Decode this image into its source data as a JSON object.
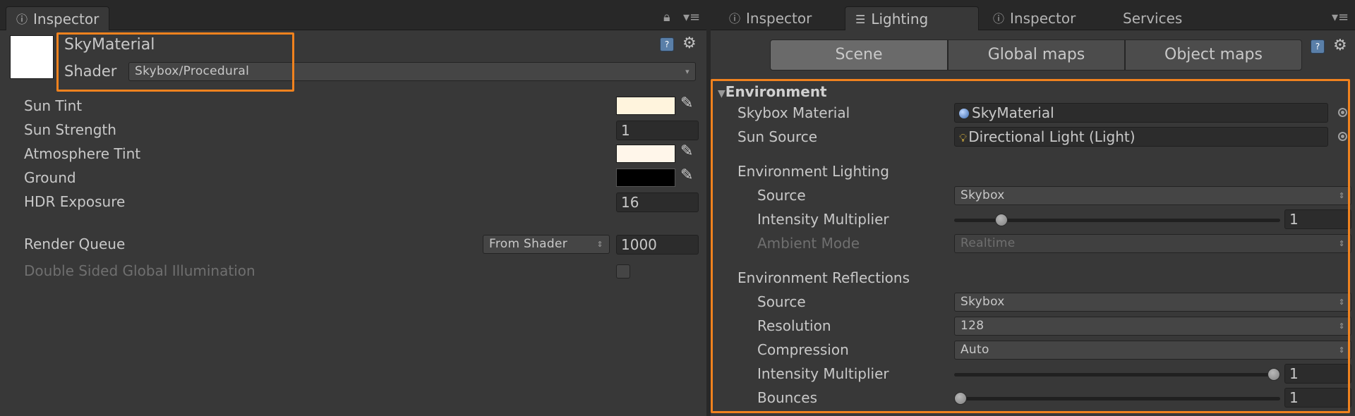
{
  "left": {
    "tab_label": "Inspector",
    "material_name": "SkyMaterial",
    "shader_label": "Shader",
    "shader_value": "Skybox/Procedural",
    "properties": [
      {
        "label": "Sun Tint",
        "color": "#fff4dd"
      },
      {
        "label": "Sun Strength",
        "value": "1"
      },
      {
        "label": "Atmosphere Tint",
        "color": "#fff6ea"
      },
      {
        "label": "Ground",
        "color": "#000000"
      },
      {
        "label": "HDR Exposure",
        "value": "16"
      }
    ],
    "render_queue": {
      "label": "Render Queue",
      "mode": "From Shader",
      "value": "1000"
    },
    "double_sided_gi": {
      "label": "Double Sided Global Illumination",
      "checked": false
    }
  },
  "right": {
    "tabs": [
      "Inspector",
      "Lighting",
      "Inspector",
      "Services"
    ],
    "active_tab": "Lighting",
    "segments": [
      "Scene",
      "Global maps",
      "Object maps"
    ],
    "active_segment": "Scene",
    "section_title": "Environment",
    "skybox_material": {
      "label": "Skybox Material",
      "value": "SkyMaterial"
    },
    "sun_source": {
      "label": "Sun Source",
      "value": "Directional Light (Light)"
    },
    "env_lighting": {
      "title": "Environment Lighting",
      "source": {
        "label": "Source",
        "value": "Skybox"
      },
      "intensity": {
        "label": "Intensity Multiplier",
        "value": "1",
        "fraction": 0.13
      },
      "ambient_mode": {
        "label": "Ambient Mode",
        "value": "Realtime"
      }
    },
    "env_reflections": {
      "title": "Environment Reflections",
      "source": {
        "label": "Source",
        "value": "Skybox"
      },
      "resolution": {
        "label": "Resolution",
        "value": "128"
      },
      "compression": {
        "label": "Compression",
        "value": "Auto"
      },
      "intensity": {
        "label": "Intensity Multiplier",
        "value": "1",
        "fraction": 1.0
      },
      "bounces": {
        "label": "Bounces",
        "value": "1",
        "fraction": 0.0
      }
    }
  },
  "colors": {
    "highlight": "#f0821e",
    "panel": "#383838",
    "tabbar": "#282828"
  },
  "icons": [
    "info-icon",
    "lock-icon",
    "menu-icon",
    "help-icon",
    "gear-icon",
    "eyedropper-icon",
    "target-icon",
    "lighting-icon",
    "material-sphere-icon",
    "light-bulb-icon"
  ]
}
